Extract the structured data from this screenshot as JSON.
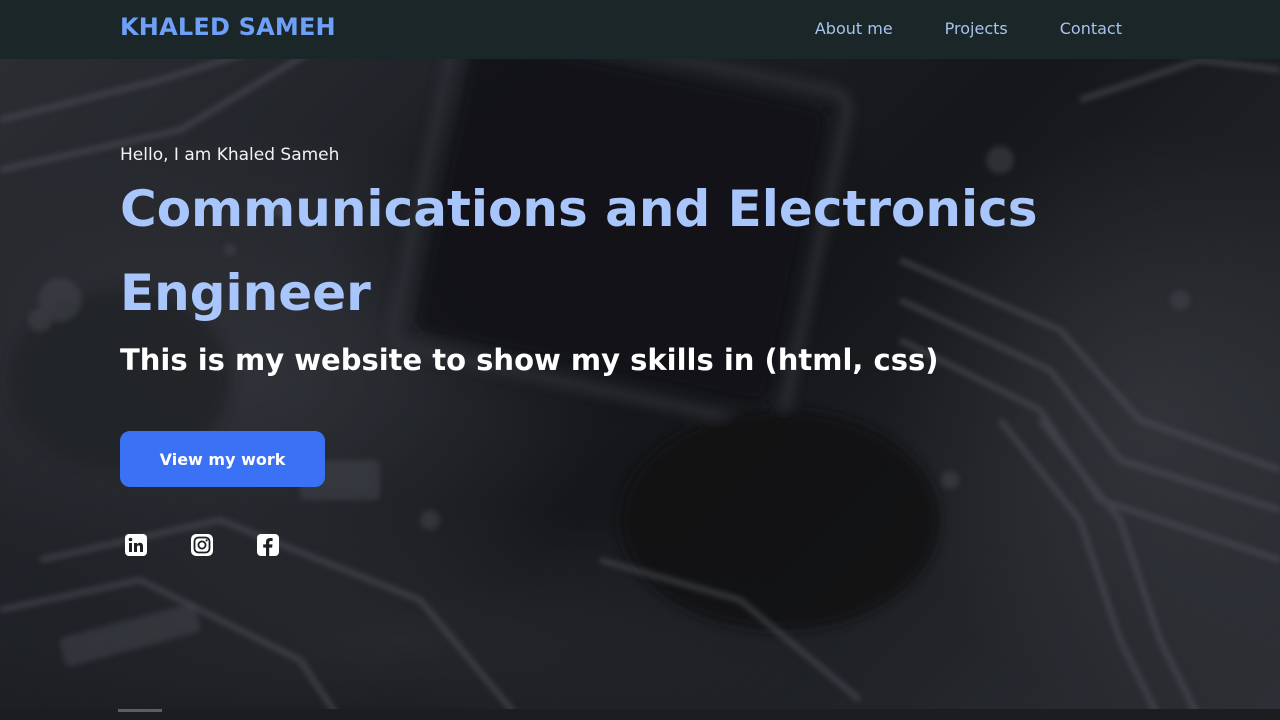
{
  "navbar": {
    "brand": "KHALED SAMEH",
    "links": [
      {
        "label": "About me"
      },
      {
        "label": "Projects"
      },
      {
        "label": "Contact"
      }
    ]
  },
  "hero": {
    "greeting": "Hello, I am Khaled Sameh",
    "headline": "Communications and Electronics Engineer",
    "subheadline": "This is my website to show my skills in (html, css)",
    "cta_label": "View my work",
    "socials": [
      {
        "icon": "linkedin-icon"
      },
      {
        "icon": "instagram-icon"
      },
      {
        "icon": "facebook-icon"
      }
    ]
  },
  "colors": {
    "navbar_bg": "#1b2628",
    "brand": "#6ea0f7",
    "nav_link": "#a6c4ef",
    "headline": "#a8c6fb",
    "cta_bg": "#3b72f5",
    "text": "#ffffff"
  }
}
